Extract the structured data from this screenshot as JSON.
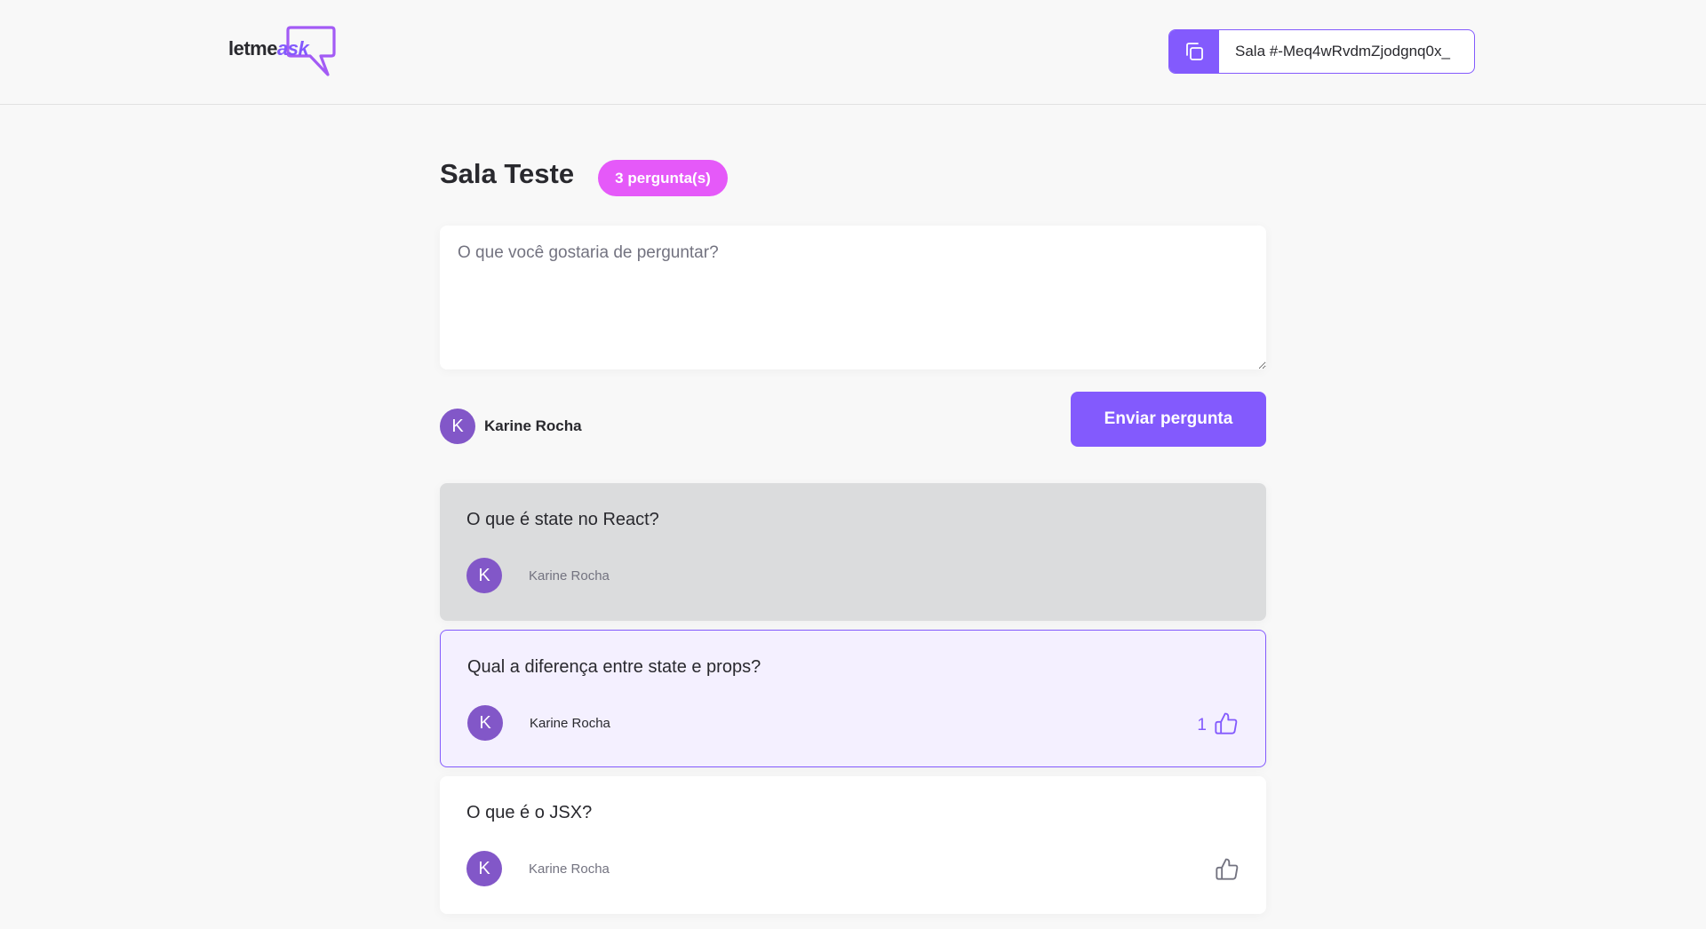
{
  "header": {
    "logo": {
      "text_main": "letme",
      "text_accent": "ask"
    },
    "room_code": {
      "label": "Sala #-Meq4wRvdmZjodgnq0x_",
      "icon": "copy-icon"
    }
  },
  "room": {
    "title": "Sala Teste",
    "question_count_label": "3 pergunta(s)"
  },
  "form": {
    "placeholder": "O que você gostaria de perguntar?",
    "value": "",
    "user": {
      "avatar_letter": "K",
      "name": "Karine Rocha"
    },
    "submit_label": "Enviar pergunta"
  },
  "questions": [
    {
      "content": "O que é state no React?",
      "author": "Karine Rocha",
      "avatar_letter": "K",
      "state": "answered",
      "likes": "",
      "show_like": false
    },
    {
      "content": "Qual a diferença entre state e props?",
      "author": "Karine Rocha",
      "avatar_letter": "K",
      "state": "highlighted",
      "likes": "1",
      "show_like": true,
      "liked": true
    },
    {
      "content": "O que é o JSX?",
      "author": "Karine Rocha",
      "avatar_letter": "K",
      "state": "normal",
      "likes": "",
      "show_like": true,
      "liked": false
    }
  ],
  "colors": {
    "accent": "#835afd",
    "badge": "#e559f9",
    "answered_bg": "#dbdcdd",
    "highlighted_bg": "#f4f0ff",
    "avatar": "#8257c8"
  }
}
